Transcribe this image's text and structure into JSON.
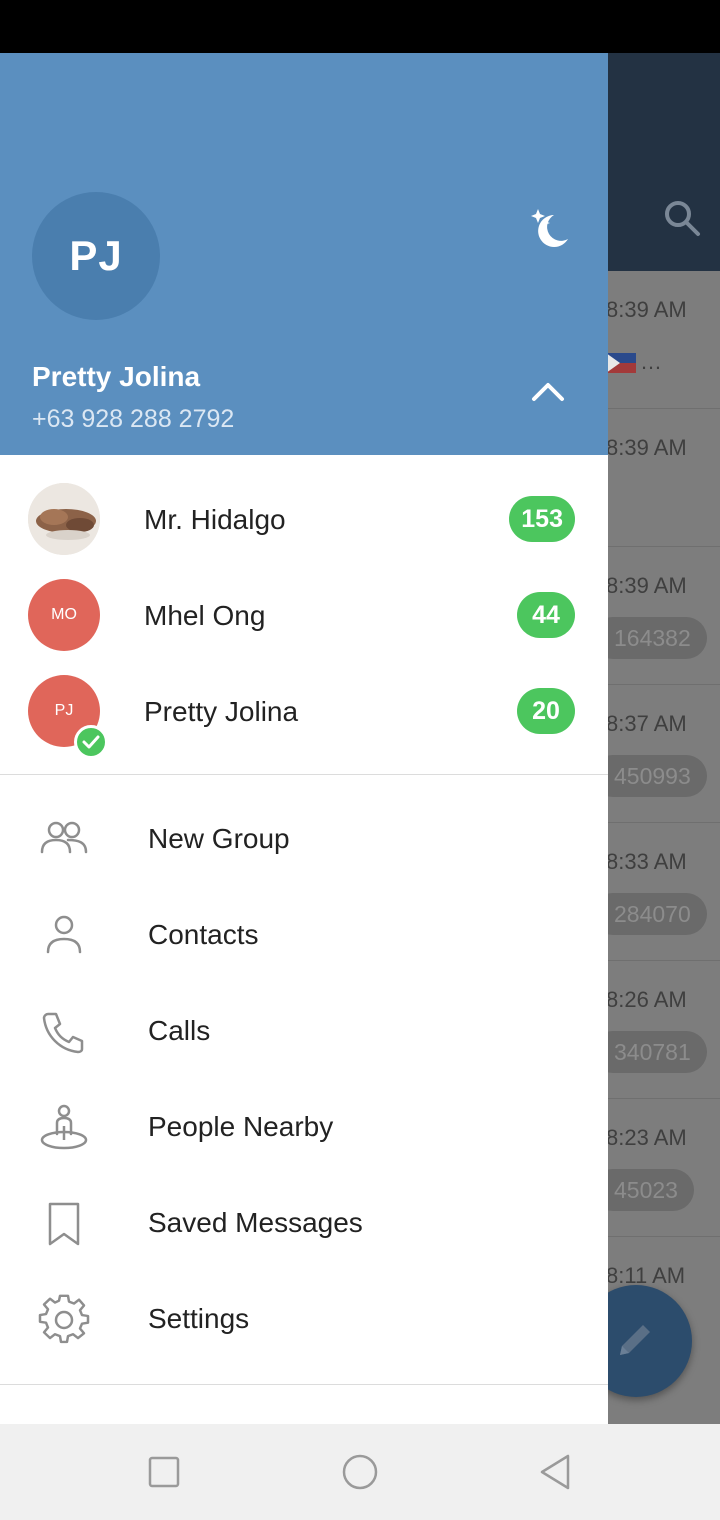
{
  "background_chats": {
    "rows": [
      {
        "time": "8:39 AM",
        "snippet": "…"
      },
      {
        "time": "8:39 AM",
        "snippet": ""
      },
      {
        "time": "8:39 AM",
        "code": "164382"
      },
      {
        "time": "8:37 AM",
        "code": "450993"
      },
      {
        "time": "8:33 AM",
        "code": "284070"
      },
      {
        "time": "8:26 AM",
        "code": "340781"
      },
      {
        "time": "8:23 AM",
        "code": "45023"
      },
      {
        "time": "8:11 AM",
        "code": ""
      }
    ]
  },
  "drawer": {
    "header": {
      "avatar_initials": "PJ",
      "name": "Pretty Jolina",
      "phone": "+63 928 288 2792",
      "night_mode_icon": "moon-stars-icon",
      "collapse_icon": "chevron-up-icon"
    },
    "accounts": [
      {
        "name": "Mr. Hidalgo",
        "badge": "153",
        "avatar": "photo"
      },
      {
        "name": "Mhel Ong",
        "badge": "44",
        "initials": "MO"
      },
      {
        "name": "Pretty Jolina",
        "badge": "20",
        "initials": "PJ",
        "active": true
      }
    ],
    "menu": [
      {
        "label": "New Group",
        "icon": "group-icon"
      },
      {
        "label": "Contacts",
        "icon": "person-icon"
      },
      {
        "label": "Calls",
        "icon": "phone-icon"
      },
      {
        "label": "People Nearby",
        "icon": "people-nearby-icon"
      },
      {
        "label": "Saved Messages",
        "icon": "bookmark-icon"
      },
      {
        "label": "Settings",
        "icon": "gear-icon"
      }
    ]
  },
  "colors": {
    "header_blue": "#5b8fbf",
    "badge_green": "#4cc65e",
    "avatar_red": "#e0665a"
  }
}
